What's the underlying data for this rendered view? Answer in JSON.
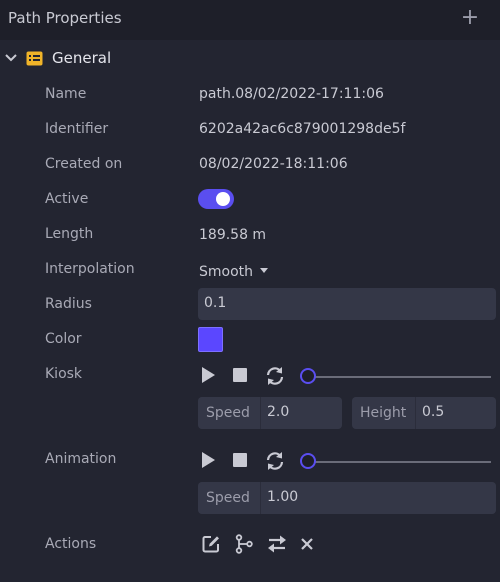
{
  "header": {
    "title": "Path Properties",
    "add_label": "+"
  },
  "section": {
    "label": "General"
  },
  "rows": {
    "name_label": "Name",
    "name_value": "path.08/02/2022-17:11:06",
    "identifier_label": "Identifier",
    "identifier_value": "6202a42ac6c879001298de5f",
    "created_label": "Created on",
    "created_value": "08/02/2022-18:11:06",
    "active_label": "Active",
    "active_on": true,
    "length_label": "Length",
    "length_value": "189.58 m",
    "interpolation_label": "Interpolation",
    "interpolation_value": "Smooth",
    "radius_label": "Radius",
    "radius_value": "0.1",
    "color_label": "Color",
    "color_value": "#5b47ff",
    "kiosk_label": "Kiosk",
    "kiosk_speed_label": "Speed",
    "kiosk_speed_value": "2.0",
    "kiosk_height_label": "Height",
    "kiosk_height_value": "0.5",
    "kiosk_progress": 0,
    "animation_label": "Animation",
    "animation_speed_label": "Speed",
    "animation_speed_value": "1.00",
    "animation_progress": 0,
    "actions_label": "Actions"
  },
  "icons": {
    "play": "play-icon",
    "stop": "stop-icon",
    "loop": "loop-icon",
    "edit": "edit-icon",
    "branch": "branch-icon",
    "swap": "swap-icon",
    "delete": "close-icon"
  },
  "colors": {
    "accent": "#5a4ef0",
    "section_icon": "#f0b429"
  }
}
